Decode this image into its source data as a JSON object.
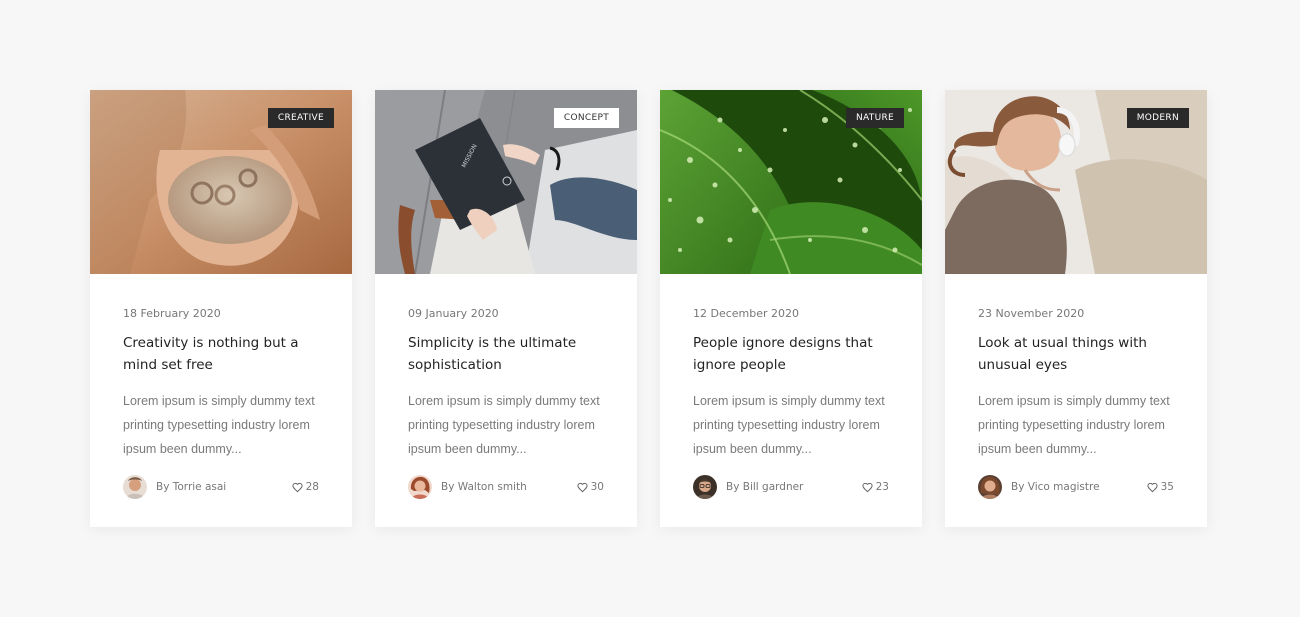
{
  "posts": [
    {
      "tag": "Creative",
      "image": "hands-holding-sand-with-rings-image",
      "date": "18 February 2020",
      "title": "Creativity is nothing but a mind set free",
      "excerpt": "Lorem ipsum is simply dummy text printing typesetting industry lorem ipsum been dummy...",
      "author": "By Torrie asai",
      "likes": "28"
    },
    {
      "tag": "Concept",
      "image": "notebook-mission-on-lap-image",
      "date": "09 January 2020",
      "title": "Simplicity is the ultimate sophistication",
      "excerpt": "Lorem ipsum is simply dummy text printing typesetting industry lorem ipsum been dummy...",
      "author": "By Walton smith",
      "likes": "30"
    },
    {
      "tag": "Nature",
      "image": "green-leaves-with-water-drops-image",
      "date": "12 December 2020",
      "title": "People ignore designs that ignore people",
      "excerpt": "Lorem ipsum is simply dummy text printing typesetting industry lorem ipsum been dummy...",
      "author": "By Bill gardner",
      "likes": "23"
    },
    {
      "tag": "Modern",
      "image": "woman-with-headphones-on-sofa-image",
      "date": "23 November 2020",
      "title": "Look at usual things with unusual eyes",
      "excerpt": "Lorem ipsum is simply dummy text printing typesetting industry lorem ipsum been dummy...",
      "author": "By Vico magistre",
      "likes": "35"
    }
  ],
  "colors": {
    "background": "#f7f7f7",
    "card": "#ffffff",
    "tag_dark": "#2a2a2a",
    "tag_light": "#ffffff",
    "title": "#232323",
    "muted": "#777777"
  },
  "icons": {
    "likes": "heart-outline-icon"
  }
}
